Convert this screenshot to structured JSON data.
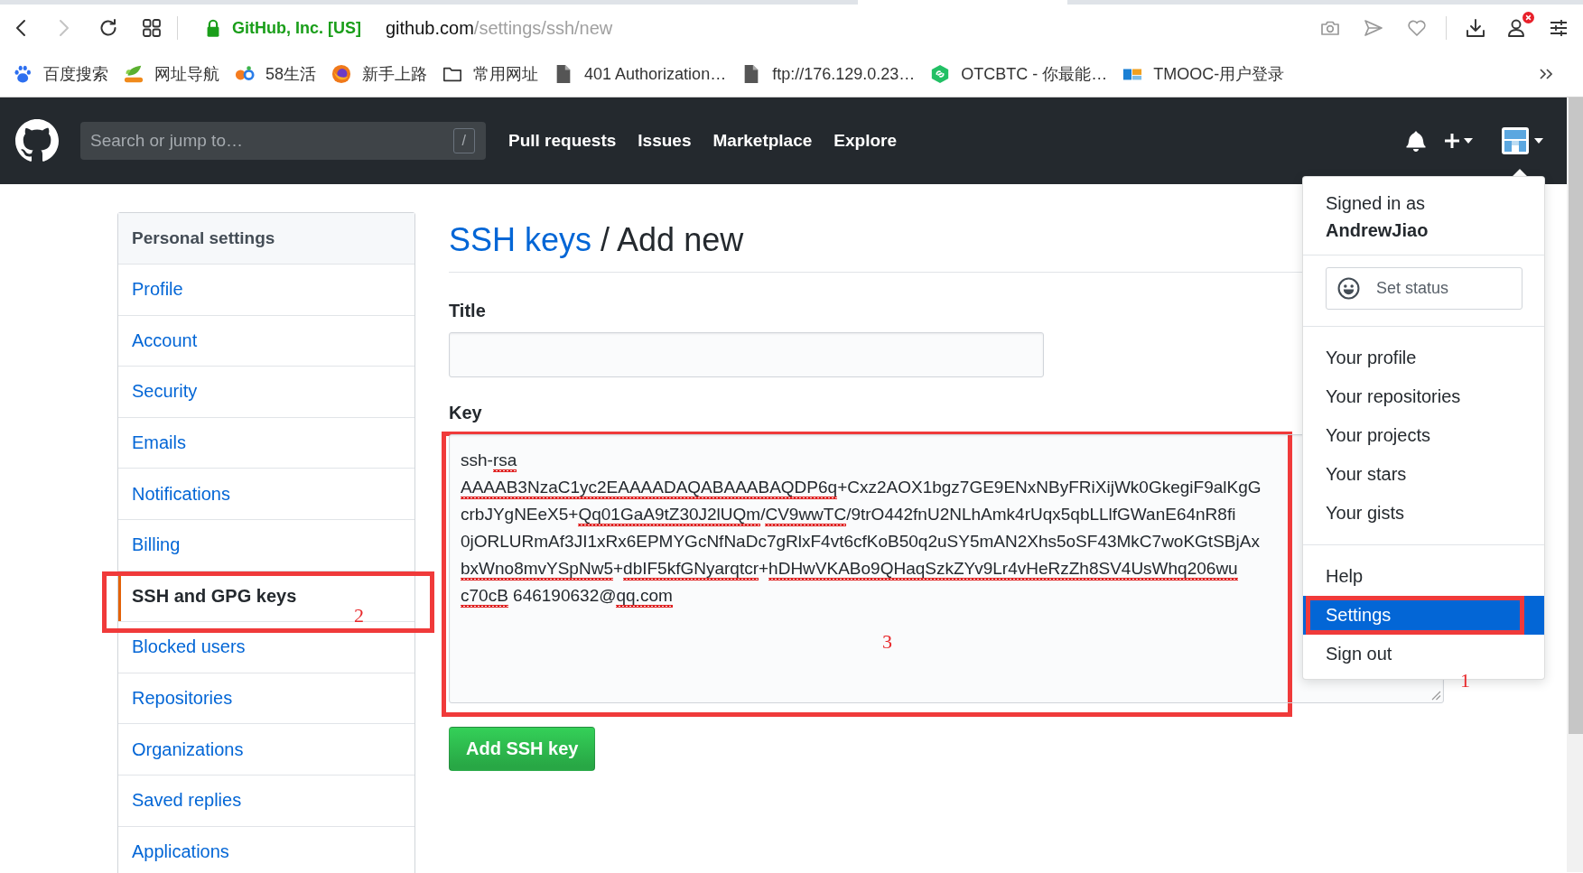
{
  "browser": {
    "nav_buttons": [
      {
        "kind": "back",
        "disabled": false
      },
      {
        "kind": "forward",
        "disabled": true
      }
    ],
    "site_identity": "GitHub, Inc. [US]",
    "url": {
      "host": "github.com",
      "path": "/settings/ssh/new"
    },
    "profile_alert": true,
    "bookmarks": [
      {
        "kind": "paw",
        "label": "百度搜索"
      },
      {
        "kind": "leaf",
        "label": "网址导航"
      },
      {
        "kind": "circles",
        "label": "58生活"
      },
      {
        "kind": "globe",
        "label": "新手上路"
      },
      {
        "kind": "folder",
        "label": "常用网址"
      },
      {
        "kind": "file",
        "label": "401 Authorization…"
      },
      {
        "kind": "file",
        "label": "ftp://176.129.0.23…"
      },
      {
        "kind": "hexagon",
        "label": "OTCBTC - 你最能…"
      },
      {
        "kind": "tile",
        "label": "TMOOC-用户登录"
      }
    ]
  },
  "header": {
    "search_placeholder": "Search or jump to…",
    "search_shortcut": "/",
    "nav": [
      "Pull requests",
      "Issues",
      "Marketplace",
      "Explore"
    ]
  },
  "sidebar": {
    "title": "Personal settings",
    "items": [
      {
        "label": "Profile",
        "selected": false
      },
      {
        "label": "Account",
        "selected": false
      },
      {
        "label": "Security",
        "selected": false
      },
      {
        "label": "Emails",
        "selected": false
      },
      {
        "label": "Notifications",
        "selected": false
      },
      {
        "label": "Billing",
        "selected": false
      },
      {
        "label": "SSH and GPG keys",
        "selected": true,
        "annotation": "2"
      },
      {
        "label": "Blocked users",
        "selected": false
      },
      {
        "label": "Repositories",
        "selected": false
      },
      {
        "label": "Organizations",
        "selected": false
      },
      {
        "label": "Saved replies",
        "selected": false
      },
      {
        "label": "Applications",
        "selected": false
      }
    ]
  },
  "page": {
    "breadcrumb_link": "SSH keys",
    "title": "/ Add new",
    "title_label": "Title",
    "key_label": "Key",
    "key": {
      "annotation": "3",
      "lines": [
        [
          {
            "text": "ssh-",
            "misspelled": false
          },
          {
            "text": "rsa",
            "misspelled": true
          }
        ],
        [
          {
            "text": "AAAAB3NzaC1yc2EAAAADAQABAAABAQDP6q",
            "misspelled": true
          },
          {
            "text": "+Cxz2AOX1bgz7GE9ENxNByFRiXijWk0GkegiF9alKgG",
            "misspelled": false
          }
        ],
        [
          {
            "text": "crbJYgNEeX5+",
            "misspelled": false
          },
          {
            "text": "Qq01GaA9tZ30J2lUQm",
            "misspelled": true
          },
          {
            "text": "/",
            "misspelled": false
          },
          {
            "text": "CV9wwTC",
            "misspelled": true
          },
          {
            "text": "/9trO442fnU2NLhAmk4rUqx5qbLLlfGWanE64nR8fi",
            "misspelled": false
          }
        ],
        [
          {
            "text": "0jORLURmAf3JI1xRx6EPMYGcNfNaDc7gRlxF4vt6cfKoB50q2uSY5mAN2Xhs5oSF43MkC7woKGtSBjAx",
            "misspelled": false
          }
        ],
        [
          {
            "text": "bxWno8mvYSpNw5",
            "misspelled": true
          },
          {
            "text": "+",
            "misspelled": false
          },
          {
            "text": "dbIF5kfGNyarqtcr",
            "misspelled": true
          },
          {
            "text": "+",
            "misspelled": false
          },
          {
            "text": "hDHwVKABo9QHaqSzkZYv9Lr4vHeRzZh8SV4UsWhq206wu",
            "misspelled": true
          }
        ],
        [
          {
            "text": "c70cB",
            "misspelled": true
          },
          {
            "text": " 646190632@",
            "misspelled": false
          },
          {
            "text": "qq.com",
            "misspelled": true
          }
        ]
      ]
    },
    "submit_button": "Add SSH key"
  },
  "user_menu": {
    "signed_in_label": "Signed in as",
    "username": "AndrewJiao",
    "status_button": "Set status",
    "sections": [
      {
        "items": [
          {
            "label": "Your profile",
            "selected": false
          },
          {
            "label": "Your repositories",
            "selected": false
          },
          {
            "label": "Your projects",
            "selected": false
          },
          {
            "label": "Your stars",
            "selected": false
          },
          {
            "label": "Your gists",
            "selected": false
          }
        ]
      },
      {
        "items": [
          {
            "label": "Help",
            "selected": false
          },
          {
            "label": "Settings",
            "selected": true,
            "annotation": "1"
          },
          {
            "label": "Sign out",
            "selected": false
          }
        ]
      }
    ]
  }
}
